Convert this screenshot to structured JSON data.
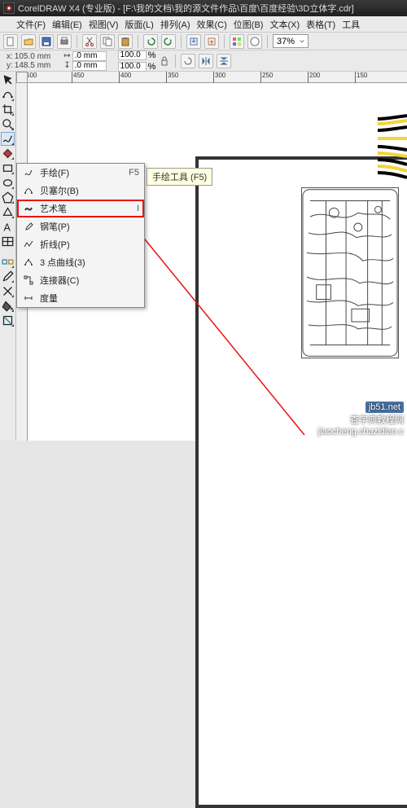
{
  "title": "CorelDRAW X4 (专业版) - [F:\\我的文档\\我的源文件作品\\百度\\百度经验\\3D立体字.cdr]",
  "menubar": {
    "file": "文件(F)",
    "edit": "编辑(E)",
    "view": "视图(V)",
    "layout": "版面(L)",
    "arrange": "排列(A)",
    "effects": "效果(C)",
    "bitmap": "位图(B)",
    "text": "文本(X)",
    "table": "表格(T)",
    "tools": "工具"
  },
  "toolbar1": {
    "zoom": "37%"
  },
  "toolbar2": {
    "x_label": "x:",
    "y_label": "y:",
    "x": "105.0 mm",
    "y": "148.5 mm",
    "w": ".0 mm",
    "h": ".0 mm",
    "sx": "100.0",
    "sy": "100.0",
    "pct": "%"
  },
  "ruler_h": [
    "500",
    "450",
    "400",
    "350",
    "300",
    "250",
    "200",
    "150"
  ],
  "ruler_v": [],
  "tooltip": "手绘工具 (F5)",
  "flyout": {
    "items": [
      {
        "label": "手绘(F)",
        "shortcut": "F5"
      },
      {
        "label": "贝塞尔(B)",
        "shortcut": ""
      },
      {
        "label": "艺术笔",
        "shortcut": "I"
      },
      {
        "label": "钢笔(P)",
        "shortcut": ""
      },
      {
        "label": "折线(P)",
        "shortcut": ""
      },
      {
        "label": "3 点曲线(3)",
        "shortcut": ""
      },
      {
        "label": "连接器(C)",
        "shortcut": ""
      },
      {
        "label": "度量",
        "shortcut": ""
      }
    ]
  },
  "watermark": {
    "badge": "jb51.net",
    "line1": "查字典教程网",
    "line2": "jiaocheng.chazidian.c"
  }
}
